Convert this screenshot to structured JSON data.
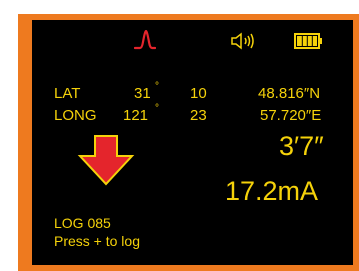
{
  "status": {
    "signal_icon": "peak-wave-icon",
    "sound_icon": "speaker-sound-icon",
    "battery_icon": "battery-icon",
    "battery_level": 1.0,
    "colors": {
      "signal": "#e4252c",
      "text": "#f5d20a",
      "frame": "#ee7a1f",
      "arrow_fill": "#e4252c",
      "arrow_stroke": "#f5d20a"
    }
  },
  "coords": {
    "lat": {
      "label": "LAT",
      "deg": "31",
      "deg_symbol": "°",
      "min": "10",
      "sec": "48.816″N"
    },
    "long": {
      "label": "LONG",
      "deg": "121",
      "deg_symbol": "°",
      "min": "23",
      "sec": "57.720″E"
    }
  },
  "direction_icon": "down-arrow-icon",
  "readings": {
    "depth": "3′7″",
    "current": "17.2mA"
  },
  "log": {
    "number": "LOG 085",
    "hint": "Press + to log"
  }
}
